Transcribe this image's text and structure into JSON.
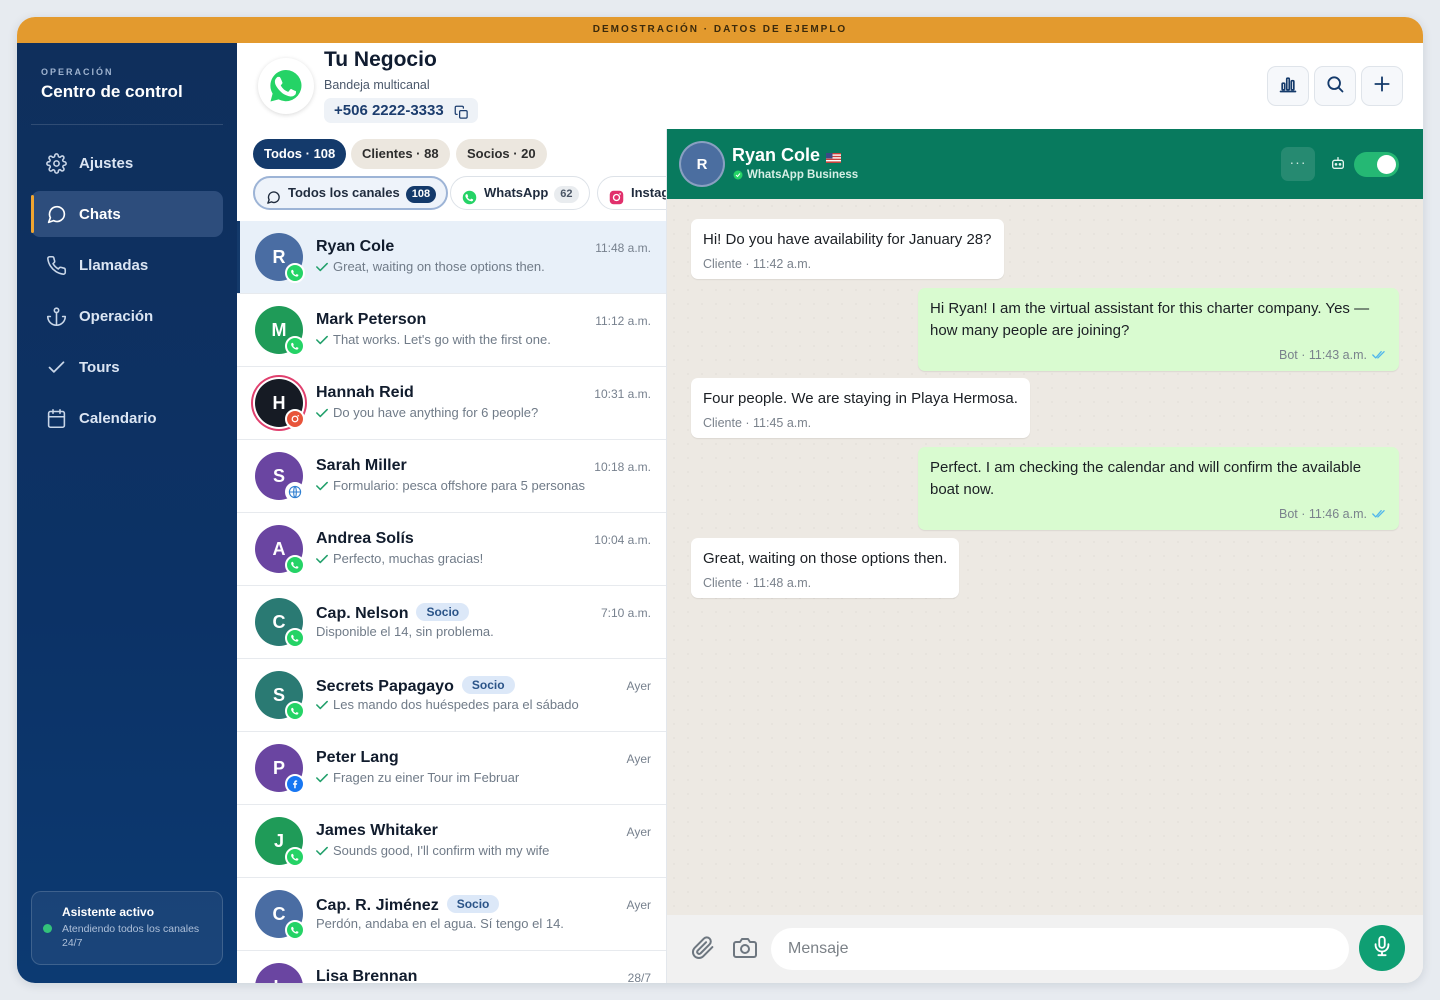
{
  "demo_banner": "DEMOSTRACIÓN · DATOS DE EJEMPLO",
  "sidebar": {
    "eyebrow": "OPERACIÓN",
    "title": "Centro de control",
    "items": [
      {
        "label": "Ajustes",
        "icon": "gear-icon"
      },
      {
        "label": "Chats",
        "icon": "chat-bubble-icon",
        "active": true
      },
      {
        "label": "Llamadas",
        "icon": "phone-icon"
      },
      {
        "label": "Operación",
        "icon": "anchor-icon"
      },
      {
        "label": "Tours",
        "icon": "check-icon"
      },
      {
        "label": "Calendario",
        "icon": "calendar-icon"
      }
    ],
    "assistant": {
      "title": "Asistente activo",
      "subtitle": "Atendiendo todos los canales 24/7",
      "status_color": "#33c27a"
    }
  },
  "header": {
    "business_name": "Tu Negocio",
    "subtitle": "Bandeja multicanal",
    "phone": "+506 2222-3333",
    "actions": [
      "stats-icon",
      "search-icon",
      "plus-icon"
    ]
  },
  "filters": {
    "segments": [
      {
        "label": "Todos · 108",
        "active": true
      },
      {
        "label": "Clientes · 88",
        "active": false
      },
      {
        "label": "Socios · 20",
        "active": false
      }
    ],
    "channels": [
      {
        "label": "Todos los canales",
        "count": "108",
        "active": true
      },
      {
        "label": "WhatsApp",
        "count": "62",
        "active": false
      },
      {
        "label": "Instagram",
        "count": "",
        "active": false
      }
    ]
  },
  "chats": [
    {
      "initial": "R",
      "name": "Ryan Cole",
      "tag": "",
      "time": "11:48 a.m.",
      "preview": "Great, waiting on those options then.",
      "checked": true,
      "channel": "whatsapp",
      "color": "#4a6da3",
      "selected": true
    },
    {
      "initial": "M",
      "name": "Mark Peterson",
      "tag": "",
      "time": "11:12 a.m.",
      "preview": "That works. Let's go with the first one.",
      "checked": true,
      "channel": "whatsapp",
      "color": "#1f9b58"
    },
    {
      "initial": "H",
      "name": "Hannah Reid",
      "tag": "",
      "time": "10:31 a.m.",
      "preview": "Do you have anything for 6 people?",
      "checked": true,
      "channel": "instagram",
      "color": "#161b24",
      "ring": true
    },
    {
      "initial": "S",
      "name": "Sarah Miller",
      "tag": "",
      "time": "10:18 a.m.",
      "preview": "Formulario: pesca offshore para 5 personas",
      "checked": true,
      "channel": "web",
      "color": "#6a45a1"
    },
    {
      "initial": "A",
      "name": "Andrea Solís",
      "tag": "",
      "time": "10:04 a.m.",
      "preview": "Perfecto, muchas gracias!",
      "checked": true,
      "channel": "whatsapp",
      "color": "#6a45a1"
    },
    {
      "initial": "C",
      "name": "Cap. Nelson",
      "tag": "Socio",
      "time": "7:10 a.m.",
      "preview": "Disponible el 14, sin problema.",
      "checked": false,
      "channel": "whatsapp",
      "color": "#2a7a73"
    },
    {
      "initial": "S",
      "name": "Secrets Papagayo",
      "tag": "Socio",
      "time": "Ayer",
      "preview": "Les mando dos huéspedes para el sábado",
      "checked": true,
      "channel": "whatsapp",
      "color": "#2a7a73"
    },
    {
      "initial": "P",
      "name": "Peter Lang",
      "tag": "",
      "time": "Ayer",
      "preview": "Fragen zu einer Tour im Februar",
      "checked": true,
      "channel": "facebook",
      "color": "#6a45a1"
    },
    {
      "initial": "J",
      "name": "James Whitaker",
      "tag": "",
      "time": "Ayer",
      "preview": "Sounds good, I'll confirm with my wife",
      "checked": true,
      "channel": "whatsapp",
      "color": "#1f9b58"
    },
    {
      "initial": "C",
      "name": "Cap. R. Jiménez",
      "tag": "Socio",
      "time": "Ayer",
      "preview": "Perdón, andaba en el agua. Sí tengo el 14.",
      "checked": false,
      "channel": "whatsapp",
      "color": "#4a6da3"
    },
    {
      "initial": "L",
      "name": "Lisa Brennan",
      "tag": "",
      "time": "28/7",
      "preview": "",
      "checked": false,
      "channel": "whatsapp",
      "color": "#6a45a1"
    }
  ],
  "conversation": {
    "contact_initial": "R",
    "contact_name": "Ryan Cole",
    "channel_label": "WhatsApp Business",
    "more_label": "···",
    "bot_enabled": true,
    "messages": [
      {
        "dir": "in",
        "text": "Hi! Do you have availability for January 28?",
        "meta": "Cliente · 11:42 a.m."
      },
      {
        "dir": "out",
        "text": "Hi Ryan! I am the virtual assistant for this charter company. Yes — how many people are joining?",
        "meta": "Bot · 11:43 a.m."
      },
      {
        "dir": "in",
        "text": "Four people. We are staying in Playa Hermosa.",
        "meta": "Cliente · 11:45 a.m."
      },
      {
        "dir": "out",
        "text": "Perfect. I am checking the calendar and will confirm the available boat now.",
        "meta": "Bot · 11:46 a.m."
      },
      {
        "dir": "in",
        "text": "Great, waiting on those options then.",
        "meta": "Cliente · 11:48 a.m."
      }
    ],
    "composer_placeholder": "Mensaje"
  },
  "colors": {
    "accent": "#143a6b",
    "whatsapp": "#25d366",
    "header_green": "#087a5e",
    "demo": "#e39a2e"
  }
}
